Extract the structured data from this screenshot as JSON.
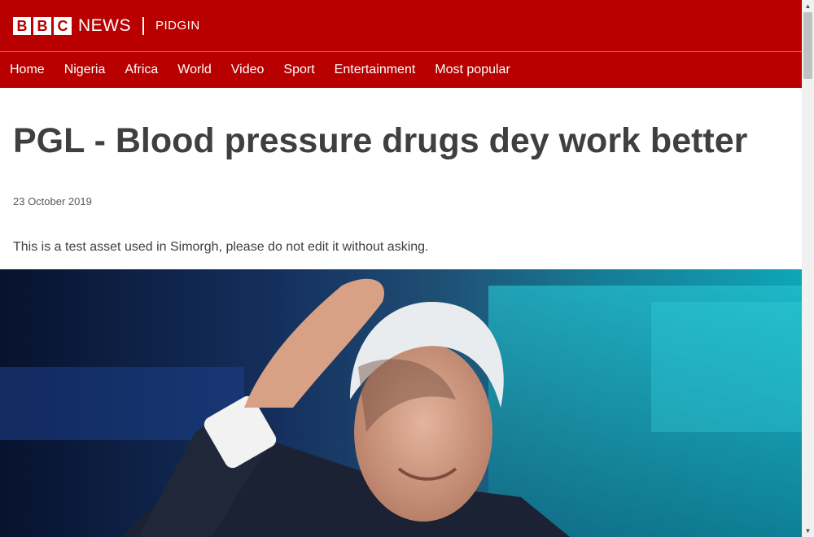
{
  "brand": {
    "letters": [
      "B",
      "B",
      "C"
    ],
    "news": "NEWS",
    "service": "PIDGIN",
    "color": "#b80000"
  },
  "nav": {
    "items": [
      "Home",
      "Nigeria",
      "Africa",
      "World",
      "Video",
      "Sport",
      "Entertainment",
      "Most popular"
    ]
  },
  "article": {
    "headline": "PGL - Blood pressure drugs dey work better",
    "date": "23 October 2019",
    "intro": "This is a test asset used in Simorgh, please do not edit it without asking."
  },
  "scrollbar": {
    "up_icon": "▲",
    "down_icon": "▼"
  }
}
